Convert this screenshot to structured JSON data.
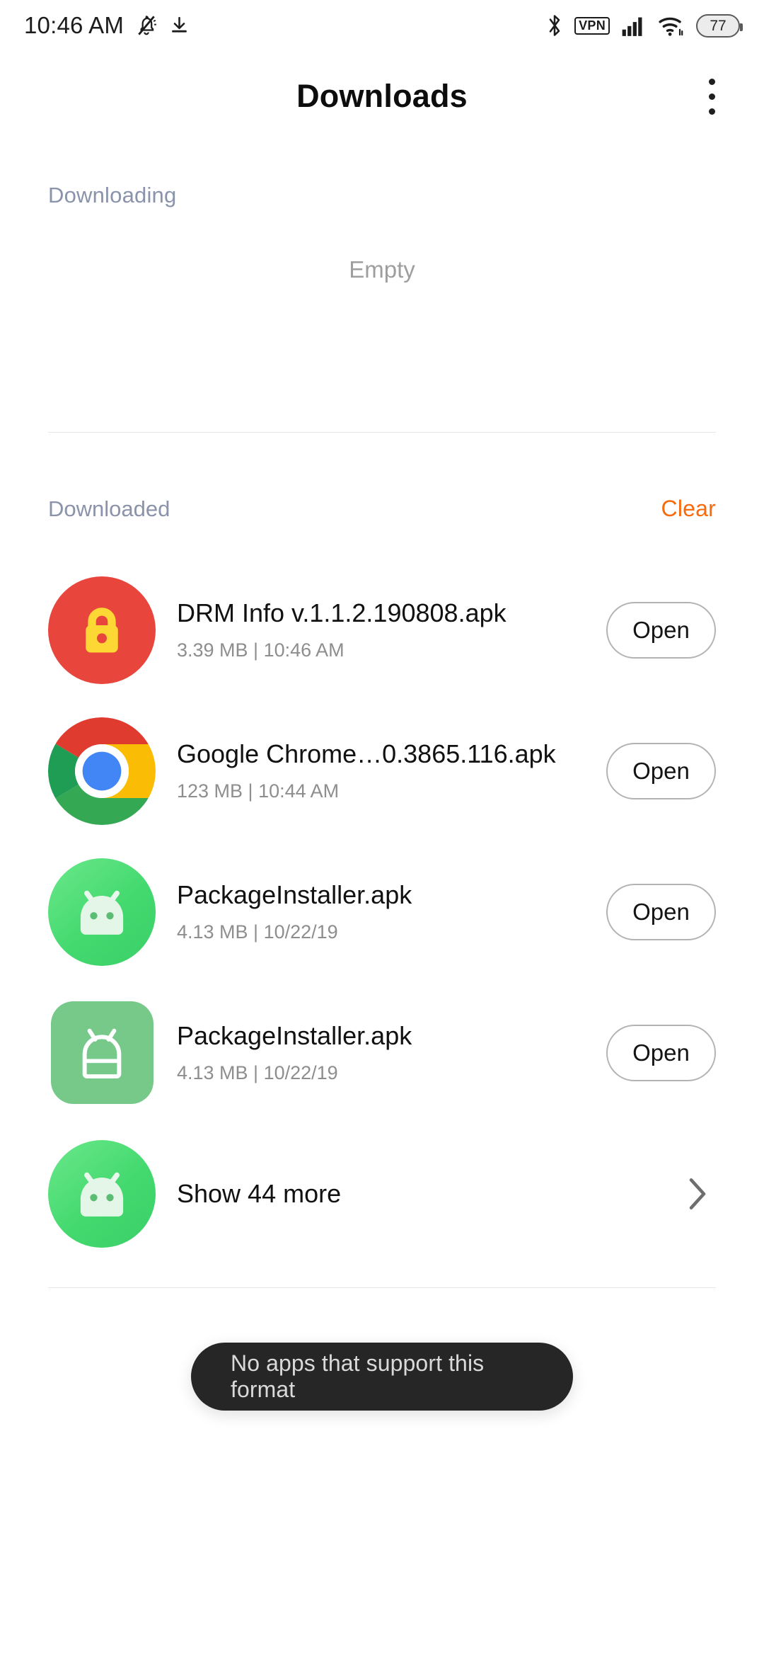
{
  "status_bar": {
    "time": "10:46 AM",
    "left_icons": [
      "notifications-off-icon",
      "download-icon"
    ],
    "right_icons": [
      "bluetooth-icon",
      "vpn-icon",
      "cellular-signal-icon",
      "wifi-icon",
      "battery-icon"
    ],
    "vpn_label": "VPN",
    "battery_level": "77"
  },
  "appbar": {
    "title": "Downloads",
    "overflow_label": "More options"
  },
  "downloading": {
    "label": "Downloading",
    "empty_text": "Empty"
  },
  "downloaded": {
    "label": "Downloaded",
    "clear_label": "Clear",
    "clear_color": "#f96a0d",
    "items": [
      {
        "icon": "lock-icon",
        "name": "DRM Info v.1.1.2.190808.apk",
        "meta": "3.39 MB | 10:46 AM",
        "action_label": "Open"
      },
      {
        "icon": "chrome-icon",
        "name": "Google Chrome…0.3865.116.apk",
        "meta": "123 MB | 10:44 AM",
        "action_label": "Open"
      },
      {
        "icon": "android-circle-icon",
        "name": "PackageInstaller.apk",
        "meta": "4.13 MB | 10/22/19",
        "action_label": "Open"
      },
      {
        "icon": "android-square-icon",
        "name": "PackageInstaller.apk",
        "meta": "4.13 MB | 10/22/19",
        "action_label": "Open"
      }
    ],
    "show_more": {
      "icon": "android-circle-icon",
      "label": "Show 44 more",
      "chevron": "chevron-right-icon"
    }
  },
  "toast": {
    "message": "No apps that support this format",
    "bg_color": "#262626",
    "text_color": "#d9d9d9"
  },
  "colors": {
    "section_header": "#8b93ab",
    "accent_orange": "#f96a0d",
    "lock_red": "#e8453c",
    "lock_yellow": "#fdd835",
    "android_green": "#44d96f",
    "android_square_green": "#77c98a"
  }
}
